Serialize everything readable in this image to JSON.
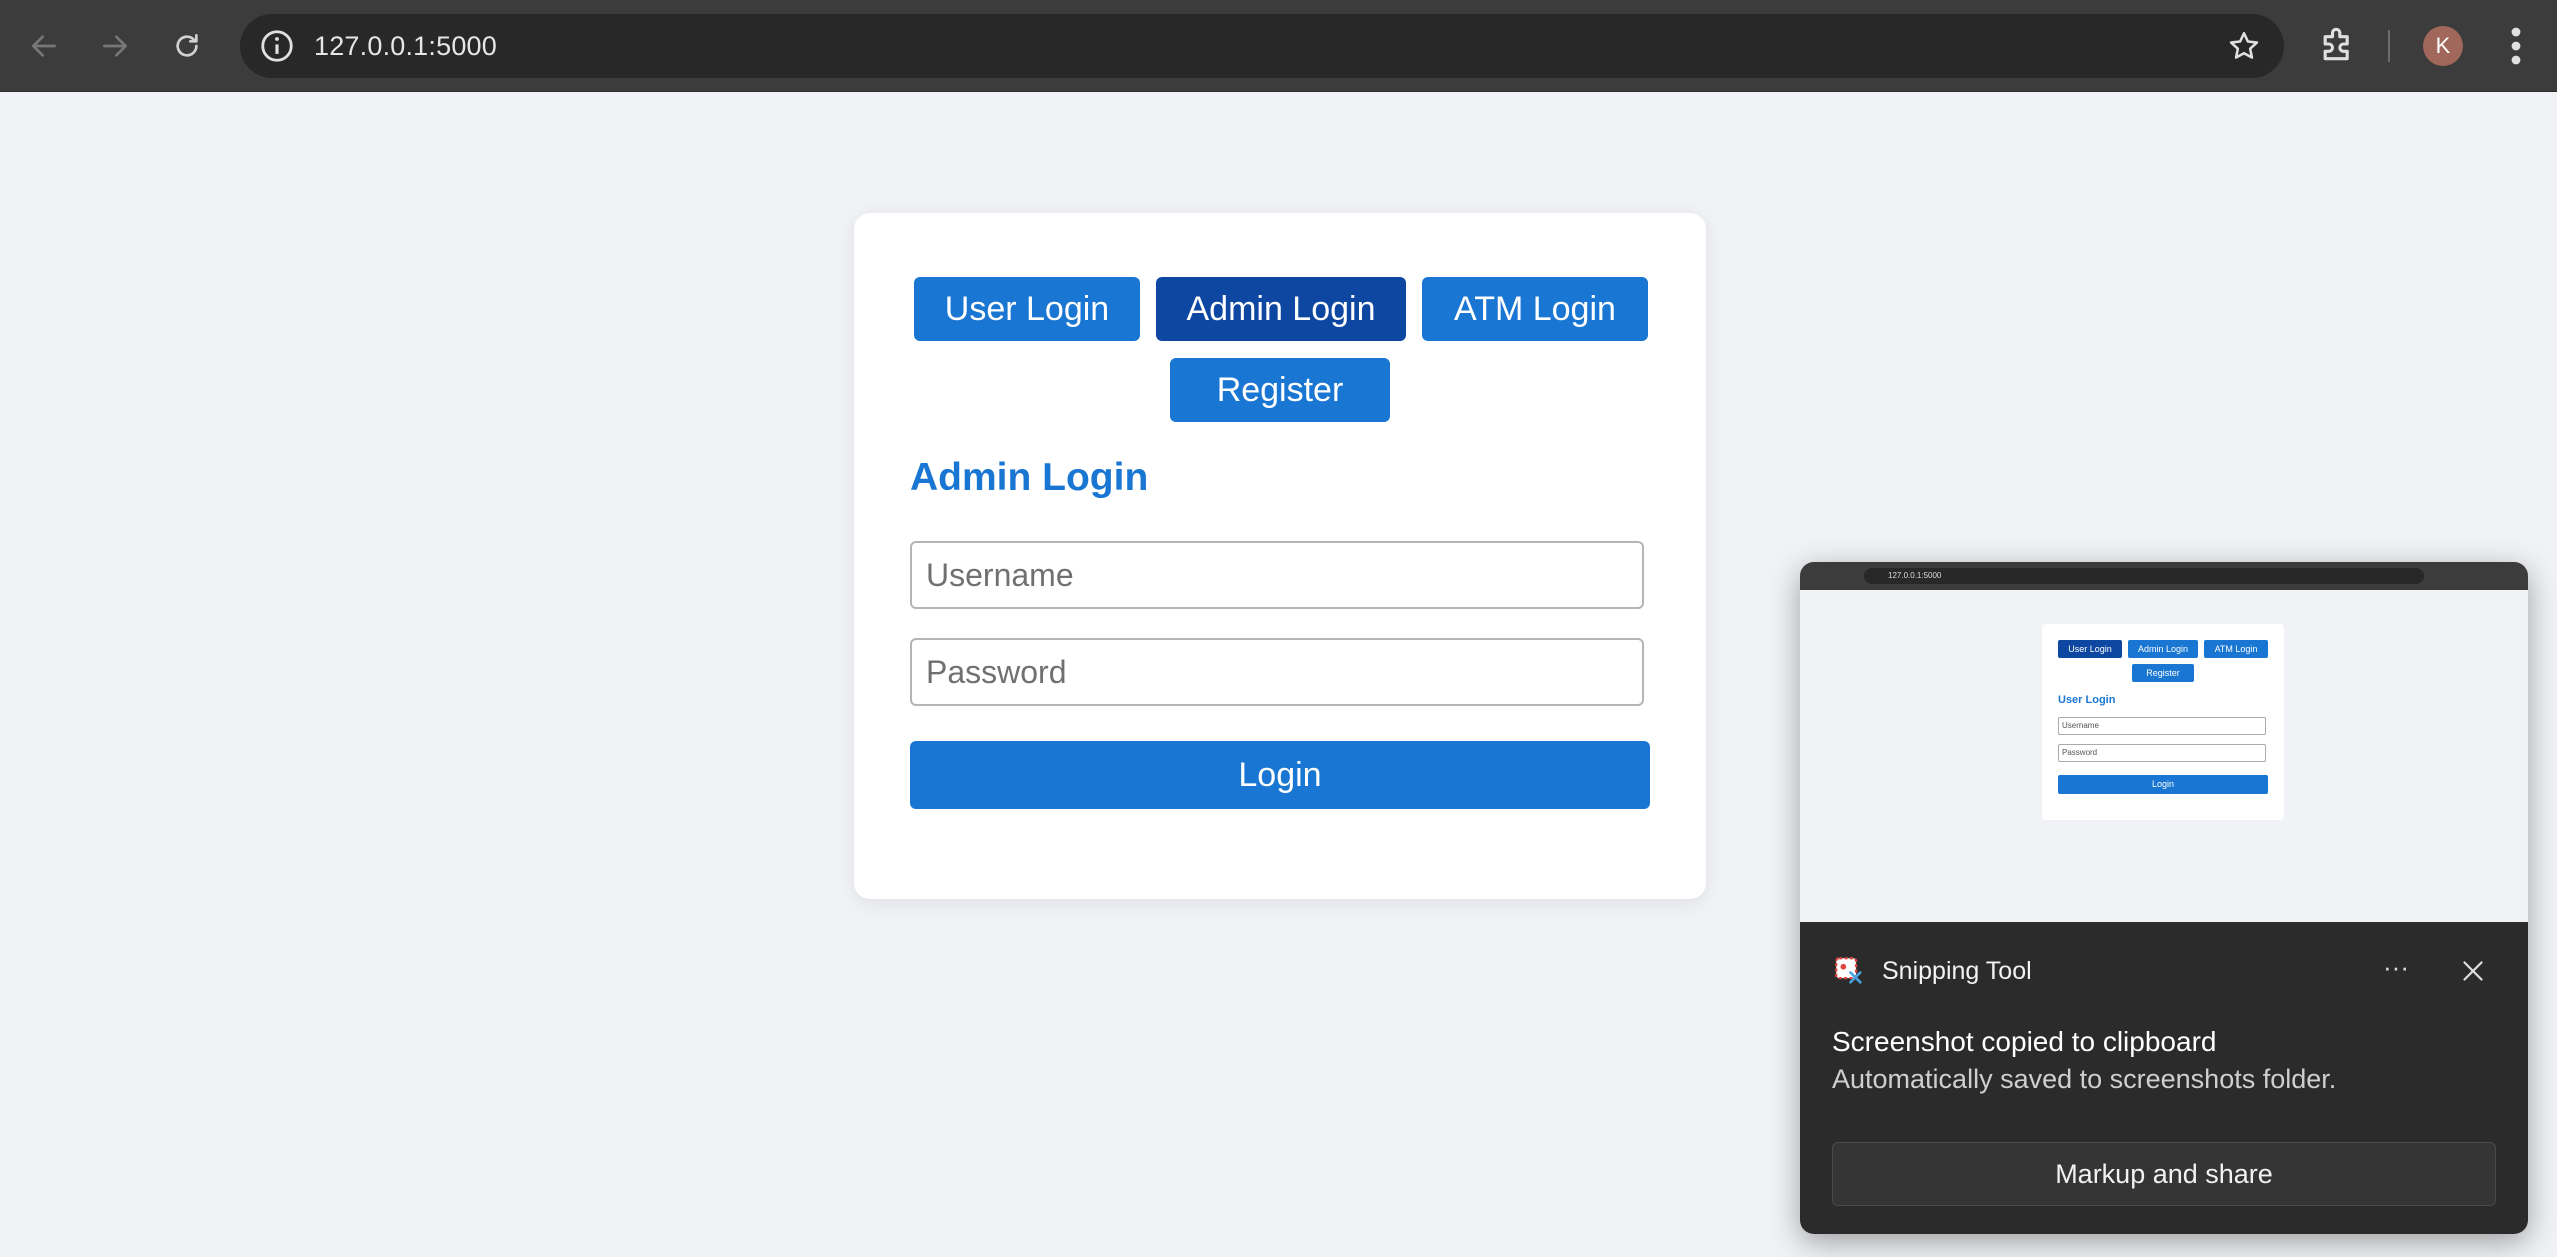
{
  "browser": {
    "url": "127.0.0.1:5000",
    "avatar_initial": "K",
    "icons": [
      "back-arrow-icon",
      "forward-arrow-icon",
      "reload-icon",
      "site-info-icon",
      "bookmark-star-icon",
      "extensions-icon",
      "more-vert-icon"
    ]
  },
  "login_card": {
    "tabs": [
      {
        "label": "User Login",
        "active": false
      },
      {
        "label": "Admin Login",
        "active": true
      },
      {
        "label": "ATM Login",
        "active": false
      },
      {
        "label": "Register",
        "active": false
      }
    ],
    "heading": "Admin Login",
    "username_placeholder": "Username",
    "password_placeholder": "Password",
    "submit_label": "Login"
  },
  "toast": {
    "app_name": "Snipping Tool",
    "more_label": "···",
    "title": "Screenshot copied to clipboard",
    "subtitle": "Automatically saved to screenshots folder.",
    "action_label": "Markup and share",
    "thumbnail": {
      "url": "127.0.0.1:5000",
      "tabs": [
        "User Login",
        "Admin Login",
        "ATM Login",
        "Register"
      ],
      "active_tab": "User Login",
      "heading": "User Login",
      "username_placeholder": "Username",
      "password_placeholder": "Password",
      "submit_label": "Login"
    }
  },
  "colors": {
    "primary": "#1976d2",
    "primary_active": "#0d47a1",
    "page_bg": "#f0f2f5",
    "toast_bg": "#2b2b2b"
  }
}
